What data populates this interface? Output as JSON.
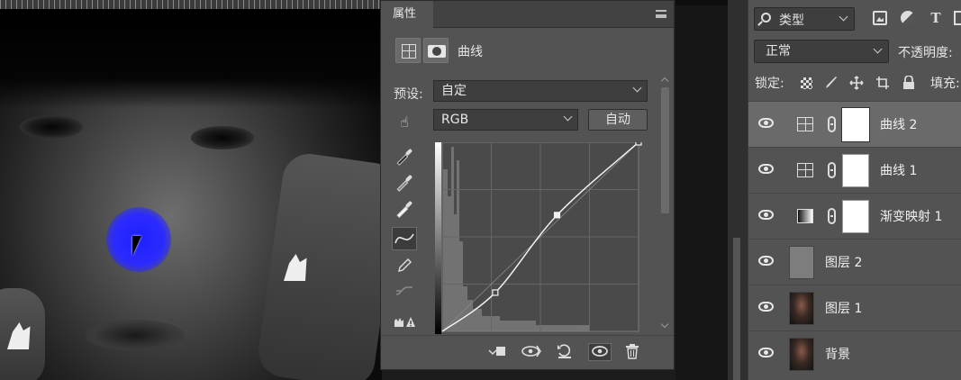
{
  "properties": {
    "tab_label": "属性",
    "adjustment_title": "曲线",
    "preset_label": "预设:",
    "preset_value": "自定",
    "channel_value": "RGB",
    "auto_label": "自动"
  },
  "curve": {
    "points": [
      [
        0,
        0
      ],
      [
        0.27,
        0.205
      ],
      [
        0.585,
        0.615
      ],
      [
        1.0,
        1.0
      ]
    ]
  },
  "layers_panel": {
    "filter_kind": "类型",
    "blend_mode": "正常",
    "opacity_label": "不透明度:",
    "lock_label": "锁定:",
    "fill_label": "填充:",
    "layers": [
      {
        "name": "曲线 2",
        "kind": "curves-adjustment",
        "visible": true,
        "selected": true
      },
      {
        "name": "曲线 1",
        "kind": "curves-adjustment",
        "visible": true,
        "selected": false
      },
      {
        "name": "渐变映射 1",
        "kind": "gradient-map-adjustment",
        "visible": true,
        "selected": false
      },
      {
        "name": "图层 2",
        "kind": "pixel-gray",
        "visible": true,
        "selected": false
      },
      {
        "name": "图层 1",
        "kind": "pixel-photo",
        "visible": true,
        "selected": false
      },
      {
        "name": "背景",
        "kind": "pixel-photo",
        "visible": true,
        "selected": false
      }
    ]
  }
}
